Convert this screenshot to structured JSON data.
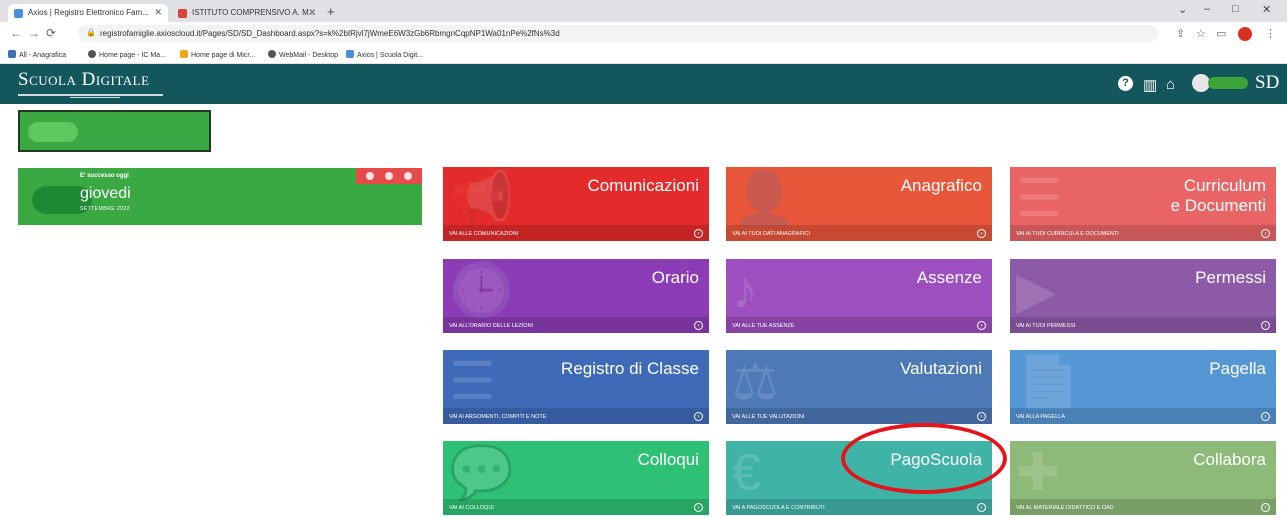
{
  "browser": {
    "tabs": [
      {
        "label": "Axios | Registro Elettronico Fam...",
        "active": true
      },
      {
        "label": "ISTITUTO COMPRENSIVO A. M...",
        "active": false
      }
    ],
    "url": "registrofamiglie.axioscloud.it/Pages/SD/SD_Dashboard.aspx?s=k%2bIRjvl7jWmeE6W3zGb6RbmgnCqpNP1Wa01nPe%2fNs%3d",
    "bookmarks": [
      "All - Anagrafica",
      "Home page - IC Ma...",
      "Home page di Micr...",
      "WebMail - Desktop",
      "Axios | Scuola Digit..."
    ]
  },
  "header": {
    "brand": "Scuola Digitale",
    "logo_short": "SD"
  },
  "today": {
    "label": "E' successo oggi",
    "day": "giovedi",
    "month": "settembre 2022"
  },
  "tiles": [
    {
      "title": "Comunicazioni",
      "sub": "Vai alle comunicazioni",
      "color": "#e32b2b"
    },
    {
      "title": "Anagrafico",
      "sub": "Vai ai tuoi dati anagrafici",
      "color": "#e8563a"
    },
    {
      "title": "Curriculum\ne Documenti",
      "sub": "Vai ai tuoi curricula e documenti",
      "color": "#e96565"
    },
    {
      "title": "Orario",
      "sub": "Vai all'orario delle lezioni",
      "color": "#8c3db6"
    },
    {
      "title": "Assenze",
      "sub": "Vai alle tue assenze",
      "color": "#9e4fbf"
    },
    {
      "title": "Permessi",
      "sub": "Vai ai tuoi permessi",
      "color": "#8d5aa8"
    },
    {
      "title": "Registro di Classe",
      "sub": "Vai ai argomenti, compiti e note",
      "color": "#3f6ab8"
    },
    {
      "title": "Valutazioni",
      "sub": "Vai alle tue valutazioni",
      "color": "#4d79b6"
    },
    {
      "title": "Pagella",
      "sub": "Vai alla pagella",
      "color": "#5596d4"
    },
    {
      "title": "Colloqui",
      "sub": "Vai ai colloqui",
      "color": "#2ec074"
    },
    {
      "title": "PagoScuola",
      "sub": "Vai a PagoScuola e contributi",
      "color": "#40b3a7"
    },
    {
      "title": "Collabora",
      "sub": "Vai al materiale didattico e dad",
      "color": "#8dba78"
    }
  ]
}
